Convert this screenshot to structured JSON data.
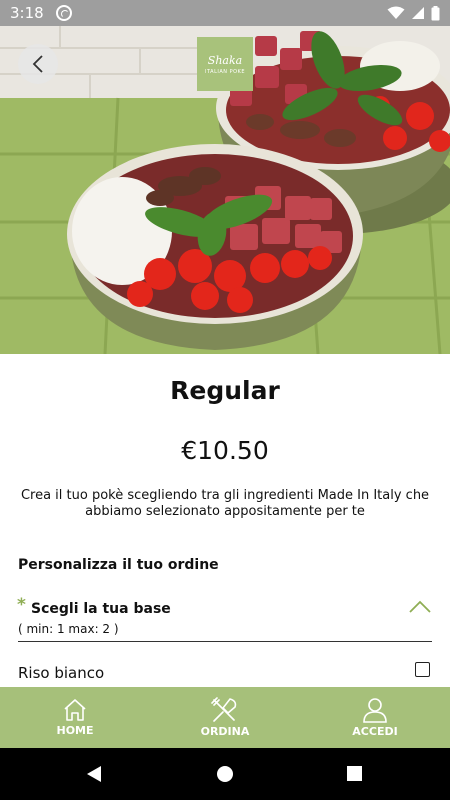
{
  "status_bar": {
    "time": "3:18"
  },
  "hero": {
    "logo_script": "Shaka",
    "logo_sub": "ITALIAN POKE"
  },
  "product": {
    "title": "Regular",
    "price": "€10.50",
    "description": "Crea il tuo pokè scegliendo tra gli ingredienti Made In Italy che abbiamo selezionato appositamente per te"
  },
  "customize": {
    "section_title": "Personalizza il tuo ordine",
    "group": {
      "required_mark": "*",
      "name": "Scegli la tua base",
      "rule": "(  min: 1 max: 2 )",
      "expanded": true
    },
    "options": [
      {
        "label": "Riso bianco",
        "checked": false
      }
    ]
  },
  "bottom_nav": {
    "items": [
      {
        "label": "HOME",
        "icon": "home-icon"
      },
      {
        "label": "ORDINA",
        "icon": "cutlery-icon"
      },
      {
        "label": "ACCEDI",
        "icon": "user-icon"
      }
    ]
  },
  "colors": {
    "accent": "#a6c07a",
    "status_bar": "#9e9e9e"
  }
}
